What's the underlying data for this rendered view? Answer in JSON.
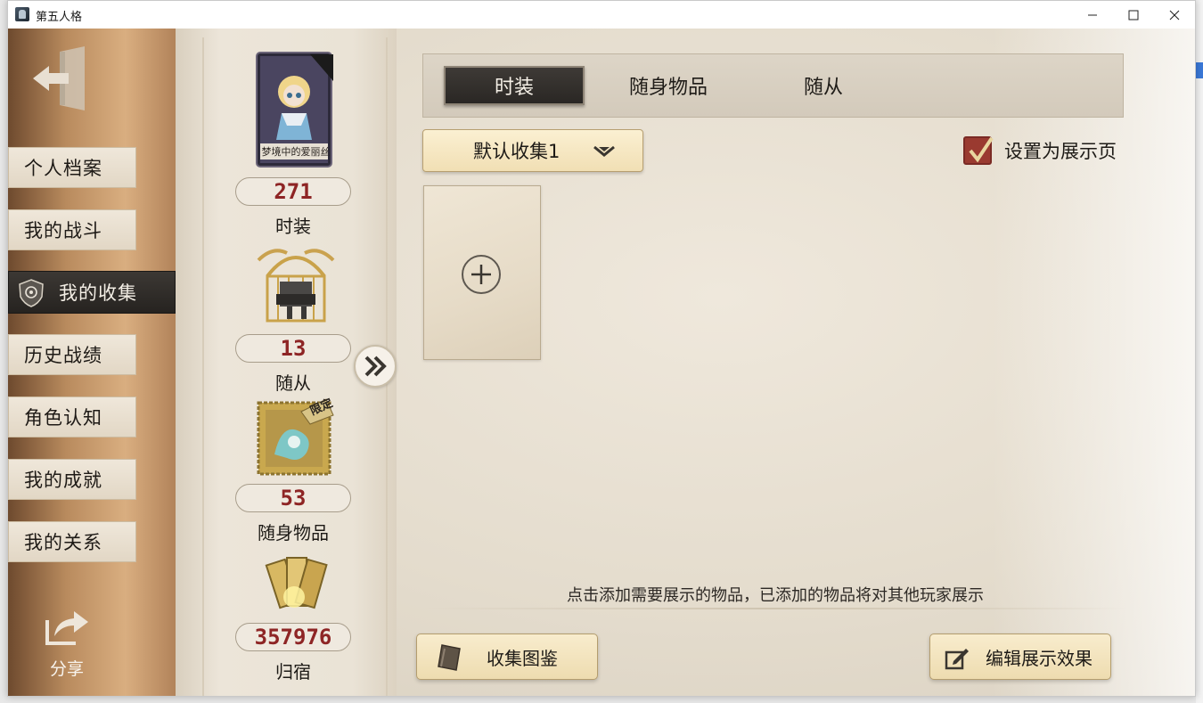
{
  "window": {
    "title": "第五人格",
    "controls": {
      "minimize": "minimize",
      "maximize": "maximize",
      "close": "close"
    }
  },
  "left_nav": {
    "items": [
      {
        "label": "个人档案",
        "active": false
      },
      {
        "label": "我的战斗",
        "active": false
      },
      {
        "label": "我的收集",
        "active": true
      },
      {
        "label": "历史战绩",
        "active": false
      },
      {
        "label": "角色认知",
        "active": false
      },
      {
        "label": "我的成就",
        "active": false
      },
      {
        "label": "我的关系",
        "active": false
      }
    ],
    "share_label": "分享"
  },
  "stats": [
    {
      "image_caption": "梦境中的爱丽丝",
      "count": "271",
      "label": "时装",
      "icon": "costume-card-icon"
    },
    {
      "count": "13",
      "label": "随从",
      "icon": "pet-cage-icon"
    },
    {
      "badge": "限定",
      "count": "53",
      "label": "随身物品",
      "icon": "stamp-item-icon"
    },
    {
      "count": "357976",
      "label": "归宿",
      "icon": "gold-bundle-icon"
    }
  ],
  "tabs": [
    {
      "label": "时装",
      "active": true
    },
    {
      "label": "随身物品",
      "active": false
    },
    {
      "label": "随从",
      "active": false
    }
  ],
  "collection_select": {
    "value": "默认收集1"
  },
  "show_as_display": {
    "label": "设置为展示页",
    "checked": true
  },
  "hint_text": "点击添加需要展示的物品，已添加的物品将对其他玩家展示",
  "buttons": {
    "collection_guide": "收集图鉴",
    "edit_display": "编辑展示效果"
  },
  "colors": {
    "accent_red": "#8e2525",
    "dark_tab": "#2a2724",
    "gold_button": "#f1dfb4"
  }
}
